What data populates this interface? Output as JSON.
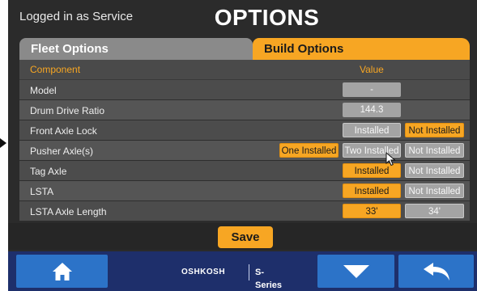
{
  "header": {
    "login_text": "Logged in as Service",
    "title": "OPTIONS"
  },
  "tabs": [
    {
      "label": "Fleet Options",
      "active": false
    },
    {
      "label": "Build Options",
      "active": true
    }
  ],
  "table": {
    "col_component": "Component",
    "col_value": "Value",
    "rows": [
      {
        "label": "Model",
        "value": "-"
      },
      {
        "label": "Drum Drive Ratio",
        "value": "144.3"
      },
      {
        "label": "Front Axle Lock",
        "options": [
          "Installed",
          "Not Installed"
        ],
        "selected": "Not Installed"
      },
      {
        "label": "Pusher Axle(s)",
        "options": [
          "One Installed",
          "Two Installed",
          "Not Installed"
        ],
        "selected": "One Installed"
      },
      {
        "label": "Tag Axle",
        "options": [
          "Installed",
          "Not Installed"
        ],
        "selected": "Installed"
      },
      {
        "label": "LSTA",
        "options": [
          "Installed",
          "Not Installed"
        ],
        "selected": "Installed"
      },
      {
        "label": "LSTA Axle Length",
        "options": [
          "33'",
          "34'"
        ],
        "selected": "33'"
      }
    ]
  },
  "save_label": "Save",
  "nav": {
    "home_icon": "home-icon",
    "down_icon": "chevron-down-icon",
    "back_icon": "back-arrow-icon",
    "brand_logo": "OSHKOSH",
    "brand_series": "S-Series"
  },
  "colors": {
    "accent": "#f7a623",
    "nav_bar": "#1e2f6b",
    "nav_button": "#2c73c8",
    "background": "#2b2b2b"
  }
}
